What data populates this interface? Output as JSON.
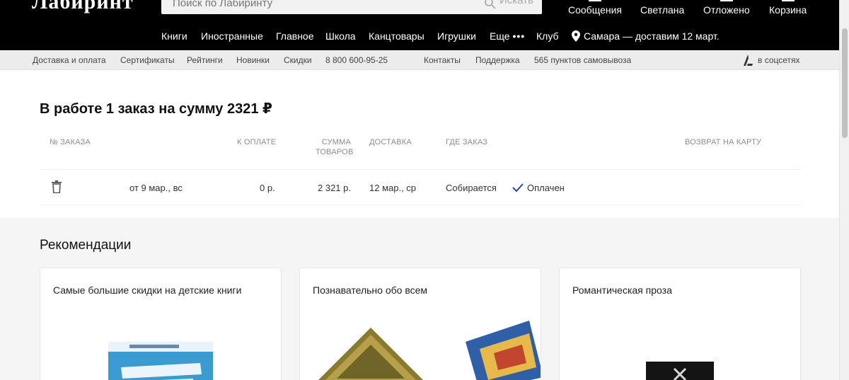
{
  "header": {
    "logo_text": "Лабиринт",
    "search": {
      "placeholder": "Поиск по Лабиринту",
      "button_label": "Искать"
    },
    "user_links": [
      {
        "label": "Сообщения"
      },
      {
        "label": "Светлана"
      },
      {
        "label": "Отложено"
      },
      {
        "label": "Корзина"
      }
    ],
    "nav": [
      {
        "label": "Книги"
      },
      {
        "label": "Иностранные"
      },
      {
        "label": "Главное"
      },
      {
        "label": "Школа"
      },
      {
        "label": "Канцтовары"
      },
      {
        "label": "Игрушки"
      },
      {
        "label": "Еще"
      },
      {
        "label": "Клуб"
      }
    ],
    "more_dots": "•••",
    "location": "Самара — доставим 12 март."
  },
  "subnav": {
    "items": [
      {
        "label": "Доставка и оплата"
      },
      {
        "label": "Сертификаты"
      },
      {
        "label": "Рейтинги"
      },
      {
        "label": "Новинки"
      },
      {
        "label": "Скидки"
      },
      {
        "label": "8 800 600-95-25"
      },
      {
        "label": "Контакты"
      },
      {
        "label": "Поддержка"
      },
      {
        "label": "565 пунктов самовывоза"
      }
    ],
    "social_label": "в соцсетях"
  },
  "orders": {
    "title": "В работе 1 заказ на сумму 2321 ₽",
    "columns": {
      "number": "№ заказа",
      "to_pay": "К оплате",
      "sum_line1": "Сумма",
      "sum_line2": "товаров",
      "delivery": "Доставка",
      "where": "Где заказ",
      "refund": "Возврат на карту"
    },
    "rows": [
      {
        "date": "от 9 мар., вс",
        "to_pay": "0 р.",
        "sum": "2 321 р.",
        "delivery": "12 мар., ср",
        "where": "Собирается",
        "payment_status": "Оплачен"
      }
    ]
  },
  "recommendations": {
    "title": "Рекомендации",
    "cards": [
      {
        "title": "Самые большие скидки на детские книги"
      },
      {
        "title": "Познавательно обо всем"
      },
      {
        "title": "Романтическая проза"
      }
    ]
  },
  "colors": {
    "header_bg": "#000000",
    "accent_check": "#1f4f8f",
    "page_bg": "#f5f5f5"
  }
}
